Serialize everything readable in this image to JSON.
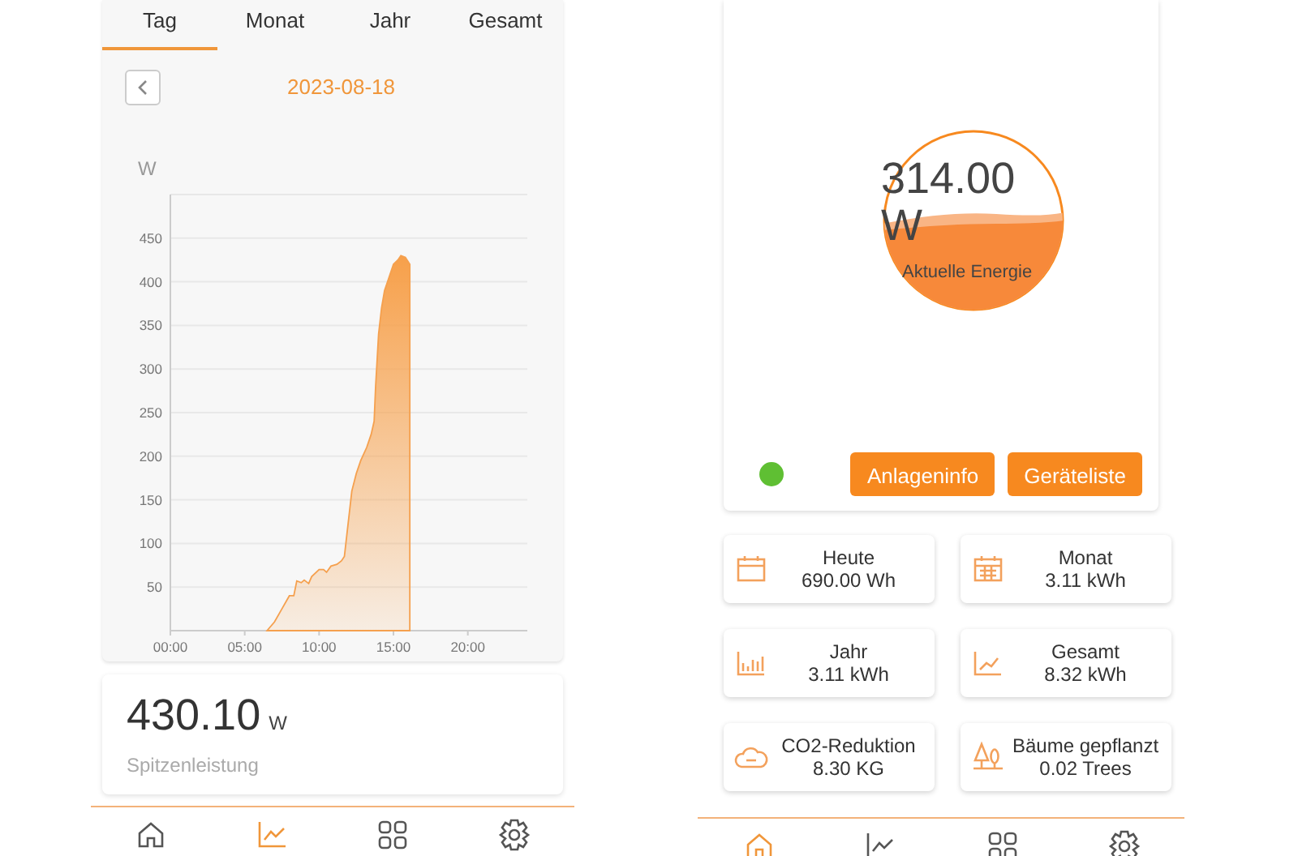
{
  "history_screen": {
    "tabs": [
      {
        "label": "Tag",
        "selected": true
      },
      {
        "label": "Monat",
        "selected": false
      },
      {
        "label": "Jahr",
        "selected": false
      },
      {
        "label": "Gesamt",
        "selected": false
      }
    ],
    "date": "2023-08-18",
    "chart_data": {
      "type": "area",
      "ylabel": "W",
      "grid": true,
      "xlim": [
        0,
        24
      ],
      "ylim": [
        0,
        500
      ],
      "xticks": [
        {
          "value": 0,
          "label": "00:00"
        },
        {
          "value": 5,
          "label": "05:00"
        },
        {
          "value": 10,
          "label": "10:00"
        },
        {
          "value": 15,
          "label": "15:00"
        },
        {
          "value": 20,
          "label": "20:00"
        }
      ],
      "yticks": [
        50,
        100,
        150,
        200,
        250,
        300,
        350,
        400,
        450
      ],
      "x": [
        6.5,
        7,
        7.5,
        8,
        8.3,
        8.5,
        8.8,
        9,
        9.3,
        9.5,
        10,
        10.3,
        10.5,
        10.8,
        11.2,
        11.5,
        11.7,
        11.8,
        12,
        12.2,
        12.5,
        12.8,
        13.2,
        13.5,
        13.7,
        13.8,
        14,
        14.2,
        14.4,
        14.7,
        15,
        15.3,
        15.5,
        15.8,
        16.1
      ],
      "series": [
        {
          "color": "#f5a04e",
          "values": [
            0,
            10,
            25,
            40,
            40,
            57,
            55,
            58,
            54,
            62,
            70,
            70,
            67,
            74,
            76,
            80,
            85,
            100,
            130,
            160,
            180,
            195,
            210,
            225,
            240,
            280,
            340,
            370,
            390,
            405,
            420,
            425,
            430,
            428,
            420
          ]
        }
      ]
    },
    "peak": {
      "value": "430.10",
      "unit": "W",
      "label": "Spitzenleistung"
    },
    "nav": [
      {
        "kind": "home",
        "selected": false
      },
      {
        "kind": "chart",
        "selected": true
      },
      {
        "kind": "grid",
        "selected": false
      },
      {
        "kind": "gear",
        "selected": false
      }
    ]
  },
  "overview_screen": {
    "gauge": {
      "value": "314.00",
      "unit": "W",
      "label": "Aktuelle Energie"
    },
    "status_dot": {
      "color": "#5fbf33"
    },
    "buttons": [
      "Anlageninfo",
      "Geräteliste"
    ],
    "stats": [
      {
        "kind": "day",
        "label": "Heute",
        "value": "690.00 Wh"
      },
      {
        "kind": "month",
        "label": "Monat",
        "value": "3.11 kWh"
      },
      {
        "kind": "year",
        "label": "Jahr",
        "value": "3.11 kWh"
      },
      {
        "kind": "total",
        "label": "Gesamt",
        "value": "8.32 kWh"
      },
      {
        "kind": "co2",
        "label": "CO2-Reduktion",
        "value": "8.30 KG"
      },
      {
        "kind": "trees",
        "label": "Bäume gepflanzt",
        "value": "0.02 Trees"
      }
    ],
    "nav": [
      {
        "kind": "home",
        "selected": true
      },
      {
        "kind": "chart",
        "selected": false
      },
      {
        "kind": "grid",
        "selected": false
      },
      {
        "kind": "gear",
        "selected": false
      }
    ]
  }
}
